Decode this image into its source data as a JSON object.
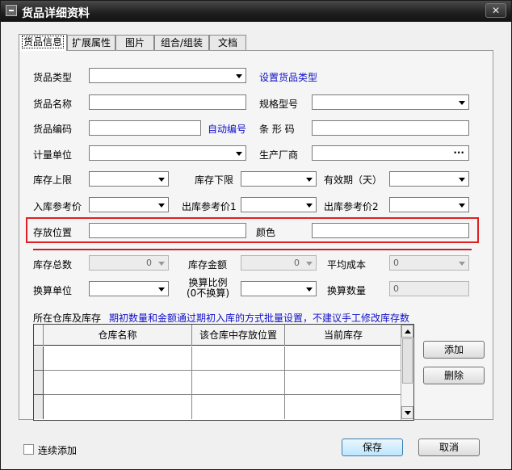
{
  "window": {
    "title": "货品详细资料",
    "close_label": "✕"
  },
  "tabs": [
    "货品信息",
    "扩展属性",
    "图片",
    "组合/组装",
    "文档"
  ],
  "labels": {
    "type": "货品类型",
    "set_type_link": "设置货品类型",
    "name": "货品名称",
    "spec": "规格型号",
    "code": "货品编码",
    "auto_code_link": "自动编号",
    "barcode": "条 形 码",
    "unit": "计量单位",
    "maker": "生产厂商",
    "stock_min": "库存上限",
    "stock_max": "库存下限",
    "expiry": "有效期（天）",
    "in_price": "入库参考价",
    "out_price1": "出库参考价1",
    "out_price2": "出库参考价2",
    "location": "存放位置",
    "color": "颜色",
    "stock_total": "库存总数",
    "stock_amount": "库存金额",
    "avg_cost": "平均成本",
    "conv_unit": "换算单位",
    "conv_ratio_1": "换算比例",
    "conv_ratio_2": "(0不换算)",
    "conv_qty": "换算数量",
    "warehouse_section": "所在仓库及库存",
    "notice": "期初数量和金额通过期初入库的方式批量设置，不建议手工修改库存数"
  },
  "values": {
    "stock_total": "0",
    "stock_amount": "0",
    "avg_cost": "0",
    "conv_qty": "0",
    "maker_button": "···"
  },
  "grid": {
    "columns": [
      "仓库名称",
      "该仓库中存放位置",
      "当前库存"
    ],
    "rows": [
      [
        "",
        "",
        ""
      ],
      [
        "",
        "",
        ""
      ],
      [
        "",
        "",
        ""
      ]
    ]
  },
  "buttons": {
    "add": "添加",
    "delete": "删除",
    "save": "保存",
    "cancel": "取消"
  },
  "continuous_add": "连续添加",
  "colors": {
    "highlight_box": "#e02020",
    "link": "#1010c8",
    "divider": "#c8202a"
  }
}
